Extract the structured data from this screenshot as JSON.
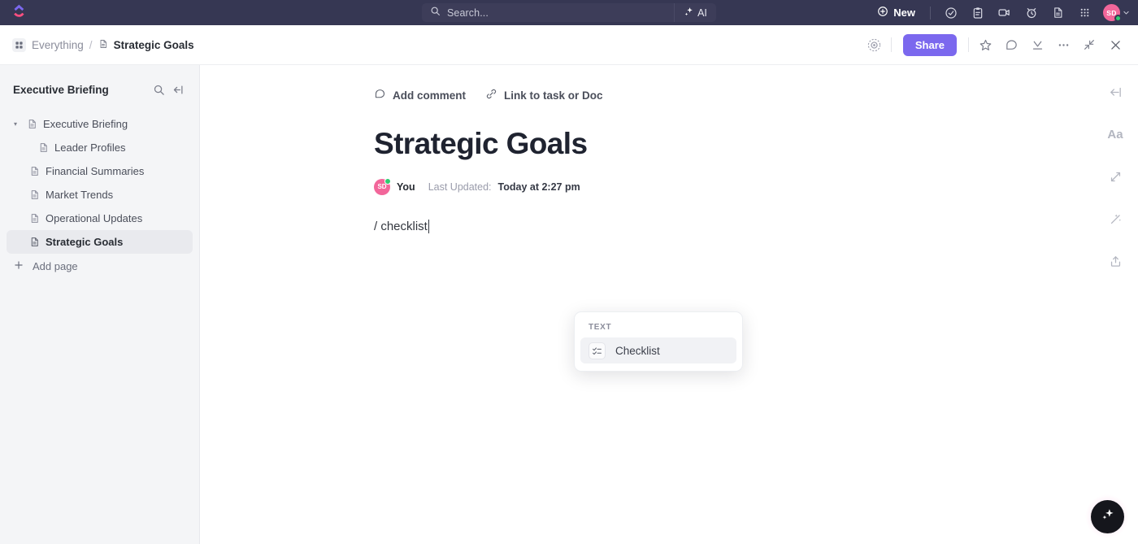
{
  "topbar": {
    "logo_icon": "clickup-logo-icon",
    "search": {
      "placeholder": "Search...",
      "icon": "search-icon"
    },
    "ai_button": {
      "label": "AI",
      "icon": "sparkle-icon"
    },
    "new_button": {
      "label": "New",
      "icon": "plus-circle-icon"
    },
    "icons": [
      {
        "name": "check-circle-icon"
      },
      {
        "name": "clipboard-icon"
      },
      {
        "name": "video-camera-icon"
      },
      {
        "name": "alarm-clock-icon"
      },
      {
        "name": "document-icon"
      },
      {
        "name": "apps-grid-icon"
      }
    ],
    "avatar": {
      "initials": "SD",
      "status": "online",
      "chevron": "chevron-down-icon"
    }
  },
  "breadcrumb": {
    "grid_icon": "apps-grid-icon",
    "root": "Everything",
    "separator": "/",
    "doc_icon": "document-icon",
    "current": "Strategic Goals"
  },
  "doc_toolbar": {
    "privacy_icon": "privacy-eye-icon",
    "share_label": "Share",
    "star_icon": "star-icon",
    "comment_icon": "comment-icon",
    "download_icon": "download-icon",
    "more_icon": "ellipsis-icon",
    "collapse_icon": "collapse-diagonal-icon",
    "close_icon": "close-icon"
  },
  "sidebar": {
    "title": "Executive Briefing",
    "search_icon": "search-icon",
    "collapse_icon": "collapse-sidebar-icon",
    "items": [
      {
        "label": "Executive Briefing",
        "indent": 0,
        "caret": "▾",
        "selected": false
      },
      {
        "label": "Leader Profiles",
        "indent": 1,
        "caret": "",
        "selected": false
      },
      {
        "label": "Financial Summaries",
        "indent": 0,
        "caret": "",
        "selected": false
      },
      {
        "label": "Market Trends",
        "indent": 0,
        "caret": "",
        "selected": false
      },
      {
        "label": "Operational Updates",
        "indent": 0,
        "caret": "",
        "selected": false
      },
      {
        "label": "Strategic Goals",
        "indent": 0,
        "caret": "",
        "selected": true
      }
    ],
    "add_page": {
      "label": "Add page",
      "icon": "plus-icon"
    }
  },
  "document": {
    "add_comment": {
      "label": "Add comment",
      "icon": "comment-icon"
    },
    "link_task": {
      "label": "Link to task or Doc",
      "icon": "link-icon"
    },
    "title": "Strategic Goals",
    "author_avatar": "SD",
    "author_label": "You",
    "updated_label": "Last Updated:",
    "updated_value": "Today at 2:27 pm",
    "slash_text": "/ checklist"
  },
  "slash_menu": {
    "category": "TEXT",
    "items": [
      {
        "label": "Checklist",
        "icon": "checklist-icon",
        "highlighted": true
      }
    ]
  },
  "right_rail": {
    "icons": [
      {
        "name": "collapse-left-icon"
      },
      {
        "name": "font-size-icon",
        "glyph": "Aa"
      },
      {
        "name": "relationship-icon"
      },
      {
        "name": "magic-wand-icon"
      },
      {
        "name": "upload-share-icon"
      }
    ],
    "fab": {
      "name": "ai-assistant-fab",
      "icon": "sparkle-icon"
    }
  },
  "colors": {
    "topbar_bg": "#363753",
    "accent_purple": "#7b68ee",
    "avatar_pink": "#f2669a",
    "status_green": "#2ecc71",
    "sidebar_bg": "#f4f5f7"
  }
}
